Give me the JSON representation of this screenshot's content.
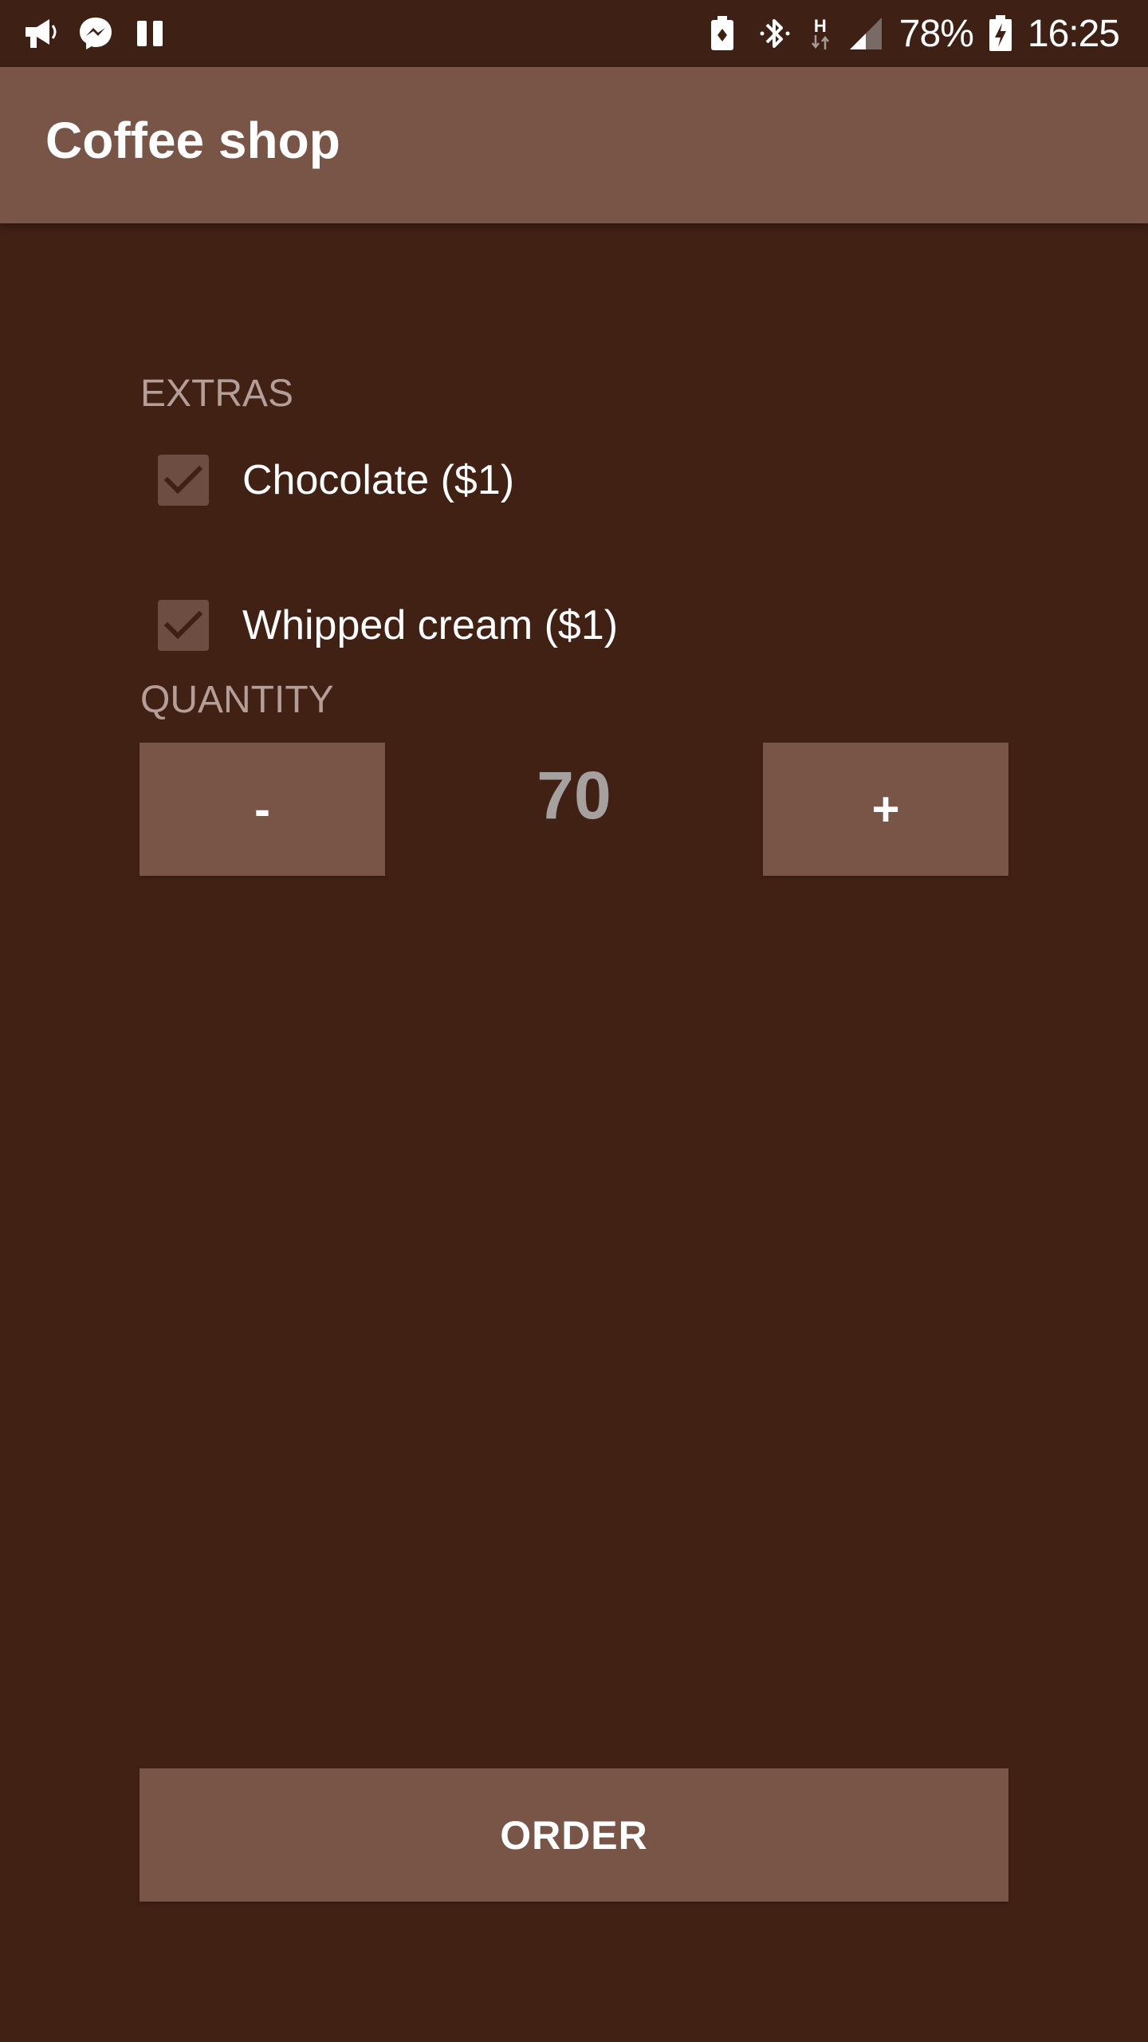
{
  "status_bar": {
    "left_icons": [
      "megaphone-icon",
      "messenger-icon",
      "pause-icon"
    ],
    "right_icons": [
      "battery-saver-icon",
      "bluetooth-icon",
      "h-data-icon",
      "signal-icon"
    ],
    "network_type": "H",
    "battery_percent": "78%",
    "time": "16:25"
  },
  "app_bar": {
    "title": "Coffee shop",
    "color": "#795548"
  },
  "extras": {
    "label": "EXTRAS",
    "options": [
      {
        "label": "Chocolate ($1)",
        "checked": true
      },
      {
        "label": "Whipped cream ($1)",
        "checked": true
      }
    ]
  },
  "quantity": {
    "label": "QUANTITY",
    "decrement_label": "-",
    "value": "70",
    "increment_label": "+"
  },
  "order": {
    "label": "ORDER"
  },
  "colors": {
    "background": "#422115",
    "primary": "#795548",
    "label_text": "#b39e98"
  }
}
